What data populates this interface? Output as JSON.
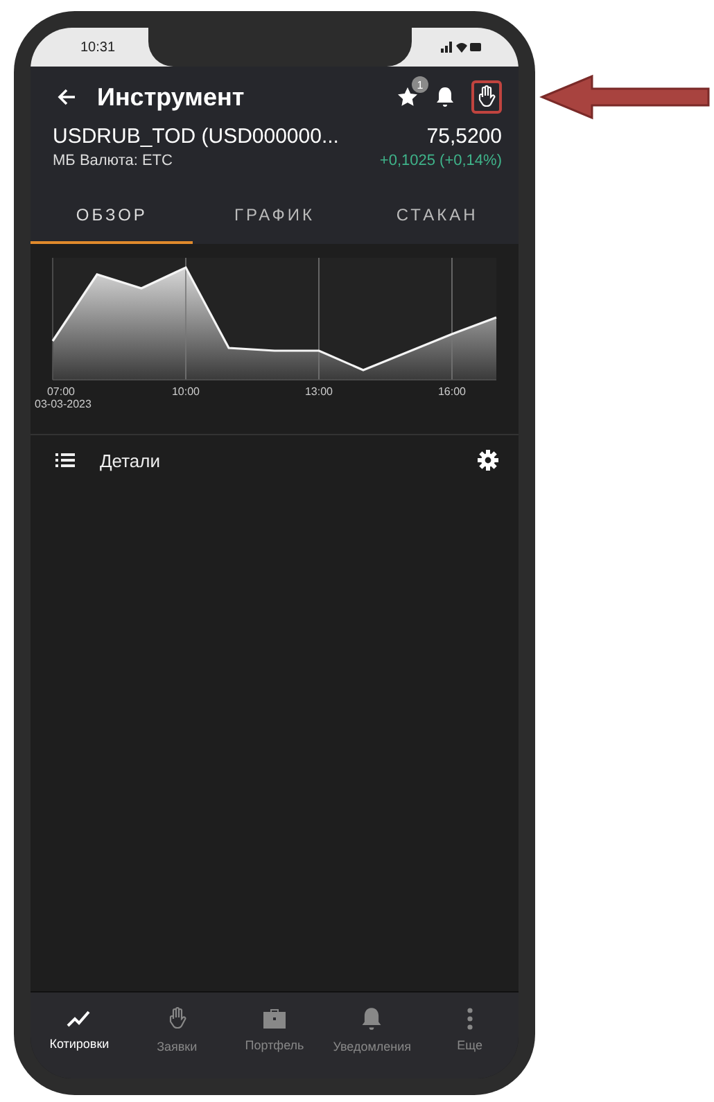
{
  "status_bar": {
    "time": "10:31"
  },
  "header": {
    "title": "Инструмент",
    "favorites_badge": "1"
  },
  "instrument": {
    "name": "USDRUB_TOD (USD000000...",
    "market": "МБ Валюта: ЕТС",
    "price": "75,5200",
    "change": "+0,1025 (+0,14%)"
  },
  "tabs": [
    {
      "label": "ОБЗОР",
      "selected": true
    },
    {
      "label": "ГРАФИК",
      "selected": false
    },
    {
      "label": "СТАКАН",
      "selected": false
    }
  ],
  "chart": {
    "x_labels": [
      "07:00",
      "10:00",
      "13:00",
      "16:00"
    ],
    "date": "03-03-2023"
  },
  "section": {
    "title": "Детали"
  },
  "bottom_nav": [
    {
      "kind": "quotes",
      "label": "Котировки",
      "selected": true
    },
    {
      "kind": "orders",
      "label": "Заявки",
      "selected": false
    },
    {
      "kind": "portfolio",
      "label": "Портфель",
      "selected": false
    },
    {
      "kind": "alerts",
      "label": "Уведомления",
      "selected": false
    },
    {
      "kind": "more",
      "label": "Еще",
      "selected": false
    }
  ]
}
